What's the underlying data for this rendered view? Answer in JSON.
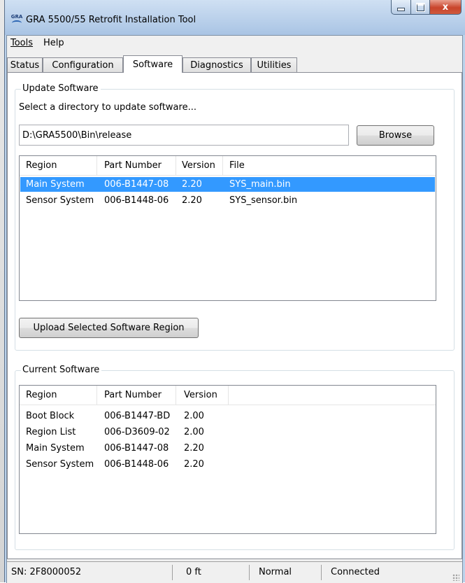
{
  "window": {
    "title": "GRA 5500/55 Retrofit Installation Tool",
    "app_icon_text": "GRA",
    "close_glyph": "x"
  },
  "menu": {
    "items": [
      {
        "label": "Tools"
      },
      {
        "label": "Help"
      }
    ]
  },
  "tabs": [
    {
      "label": "Status",
      "active": false
    },
    {
      "label": "Configuration",
      "active": false
    },
    {
      "label": "Software",
      "active": true
    },
    {
      "label": "Diagnostics",
      "active": false
    },
    {
      "label": "Utilities",
      "active": false
    }
  ],
  "update_software": {
    "title": "Update Software",
    "prompt": "Select a directory to update software...",
    "path_value": "D:\\GRA5500\\Bin\\release",
    "browse_label": "Browse",
    "columns": [
      "Region",
      "Part Number",
      "Version",
      "File"
    ],
    "rows": [
      {
        "region": "Main System",
        "part": "006-B1447-08",
        "version": "2.20",
        "file": "SYS_main.bin",
        "selected": true
      },
      {
        "region": "Sensor System",
        "part": "006-B1448-06",
        "version": "2.20",
        "file": "SYS_sensor.bin",
        "selected": false
      }
    ],
    "upload_label": "Upload Selected Software Region"
  },
  "current_software": {
    "title": "Current Software",
    "columns": [
      "Region",
      "Part Number",
      "Version"
    ],
    "rows": [
      {
        "region": "Boot Block",
        "part": "006-B1447-BD",
        "version": "2.00"
      },
      {
        "region": "Region List",
        "part": "006-D3609-02",
        "version": "2.00"
      },
      {
        "region": "Main System",
        "part": "006-B1447-08",
        "version": "2.20"
      },
      {
        "region": "Sensor System",
        "part": "006-B1448-06",
        "version": "2.20"
      }
    ]
  },
  "status_bar": {
    "serial": "SN: 2F8000052",
    "depth": "0 ft",
    "mode": "Normal",
    "connection": "Connected"
  },
  "colors": {
    "selection": "#3399ff",
    "title_bar": "#bcd3ec",
    "close_button": "#c8442b"
  }
}
